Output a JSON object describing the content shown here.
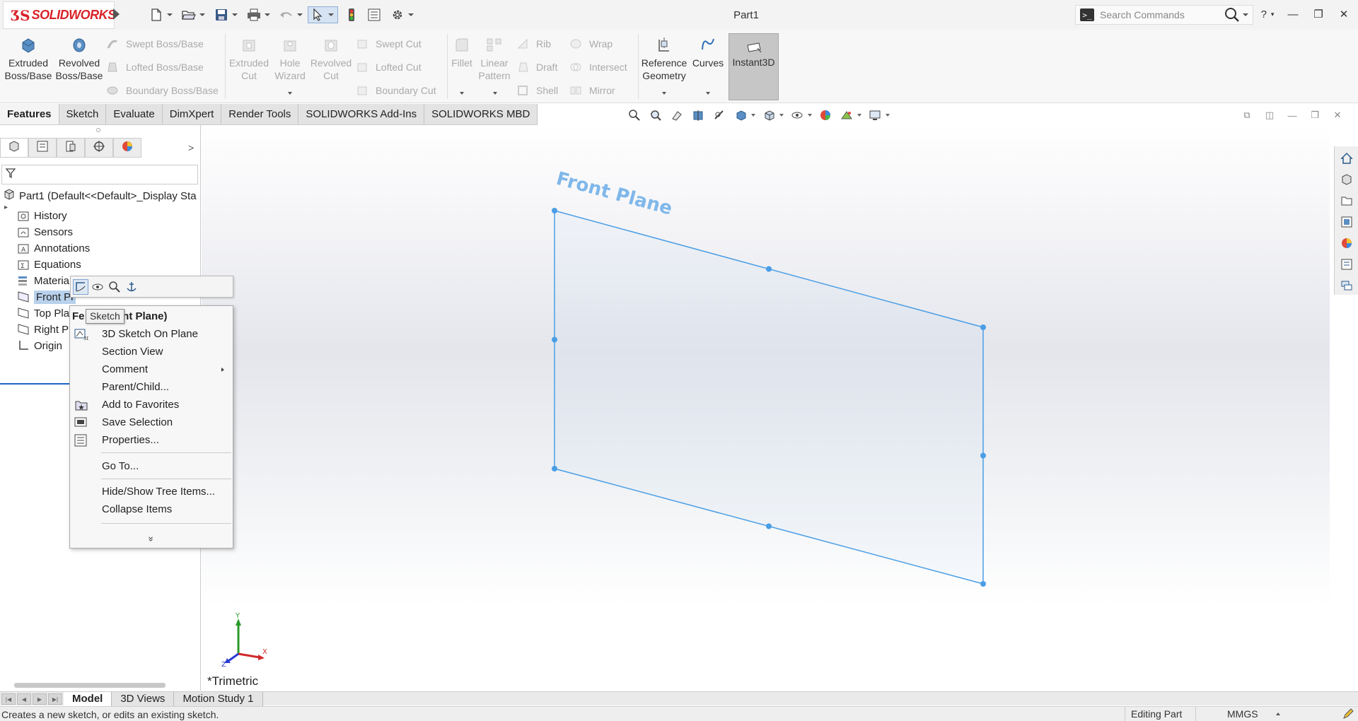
{
  "app": {
    "brand": "SOLIDWORKS",
    "document_title": "Part1",
    "search_placeholder": "Search Commands",
    "help_label": "?"
  },
  "ribbon": {
    "extruded_boss": "Extruded Boss/Base",
    "revolved_boss": "Revolved Boss/Base",
    "swept_boss": "Swept Boss/Base",
    "lofted_boss": "Lofted Boss/Base",
    "boundary_boss": "Boundary Boss/Base",
    "extruded_cut": "Extruded Cut",
    "hole_wizard": "Hole Wizard",
    "revolved_cut": "Revolved Cut",
    "swept_cut": "Swept Cut",
    "lofted_cut": "Lofted Cut",
    "boundary_cut": "Boundary Cut",
    "fillet": "Fillet",
    "linear_pattern": "Linear Pattern",
    "rib": "Rib",
    "draft": "Draft",
    "shell": "Shell",
    "wrap": "Wrap",
    "intersect": "Intersect",
    "mirror": "Mirror",
    "reference_geometry": "Reference Geometry",
    "curves": "Curves",
    "instant3d": "Instant3D"
  },
  "tabs": [
    "Features",
    "Sketch",
    "Evaluate",
    "DimXpert",
    "Render Tools",
    "SOLIDWORKS Add-Ins",
    "SOLIDWORKS MBD"
  ],
  "tree": {
    "root": "Part1  (Default<<Default>_Display Sta",
    "items": [
      {
        "label": "History",
        "icon": "history-folder-icon"
      },
      {
        "label": "Sensors",
        "icon": "sensors-folder-icon"
      },
      {
        "label": "Annotations",
        "icon": "annotations-folder-icon"
      },
      {
        "label": "Equations",
        "icon": "equations-folder-icon"
      },
      {
        "label": "Materia",
        "icon": "material-icon"
      },
      {
        "label": "Front Pl",
        "icon": "plane-icon"
      },
      {
        "label": "Top Pla",
        "icon": "plane-icon"
      },
      {
        "label": "Right Pl",
        "icon": "plane-icon"
      },
      {
        "label": "Origin",
        "icon": "origin-icon"
      }
    ]
  },
  "viewport": {
    "plane_label": "Front Plane",
    "view_orientation": "*Trimetric",
    "plane_color": "#4a9ee6",
    "triad": {
      "x": "X",
      "y": "Y",
      "z": "Z"
    }
  },
  "context_menu": {
    "header_pre": "Fe",
    "header_post": "ont Plane)",
    "tooltip": "Sketch",
    "items": [
      {
        "label": "3D Sketch On Plane",
        "icon": "3d-sketch-icon"
      },
      {
        "label": "Section View",
        "icon": ""
      },
      {
        "label": "Comment",
        "icon": "",
        "submenu": true
      },
      {
        "label": "Parent/Child...",
        "icon": ""
      },
      {
        "label": "Add to Favorites",
        "icon": "favorites-icon"
      },
      {
        "label": "Save Selection",
        "icon": "save-selection-icon"
      },
      {
        "label": "Properties...",
        "icon": "properties-icon"
      },
      {
        "label": "Go To...",
        "icon": ""
      },
      {
        "label": "Hide/Show Tree Items...",
        "icon": ""
      },
      {
        "label": "Collapse Items",
        "icon": ""
      }
    ],
    "expand_label": "»"
  },
  "bottom_tabs": [
    "Model",
    "3D Views",
    "Motion Study 1"
  ],
  "status": {
    "message": "Creates a new sketch, or edits an existing sketch.",
    "mode": "Editing Part",
    "units": "MMGS"
  }
}
